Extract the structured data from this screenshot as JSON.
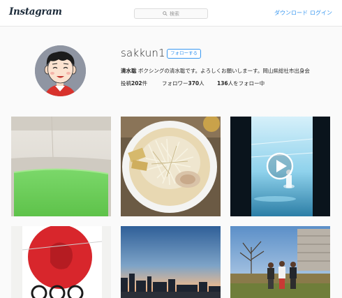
{
  "header": {
    "logo_text": "Instagram",
    "search_placeholder": "検索",
    "search_icon": "search-icon",
    "download_label": "ダウンロード",
    "login_label": "ログイン",
    "link_color": "#3897f0"
  },
  "profile": {
    "username": "sakkun1",
    "follow_label": "フォローする",
    "bio_name": "清水聡",
    "bio_text": " ボクシングの清水聡です。よろしくお願いしまーす。岡山県総社市出身会",
    "posts_prefix": "投稿",
    "posts_count": "202",
    "posts_suffix": "件",
    "followers_prefix": "フォロワー",
    "followers_count": "370",
    "followers_suffix": "人",
    "following_count": "136",
    "following_suffix": "人をフォロー中"
  },
  "posts": [
    {
      "subject": "green-bathtub-photo"
    },
    {
      "subject": "ramen-bowl-photo"
    },
    {
      "subject": "boxing-ring-video",
      "icon": "play-icon"
    },
    {
      "subject": "olympic-poster-photo"
    },
    {
      "subject": "city-sunset-photo"
    },
    {
      "subject": "group-park-photo"
    }
  ]
}
